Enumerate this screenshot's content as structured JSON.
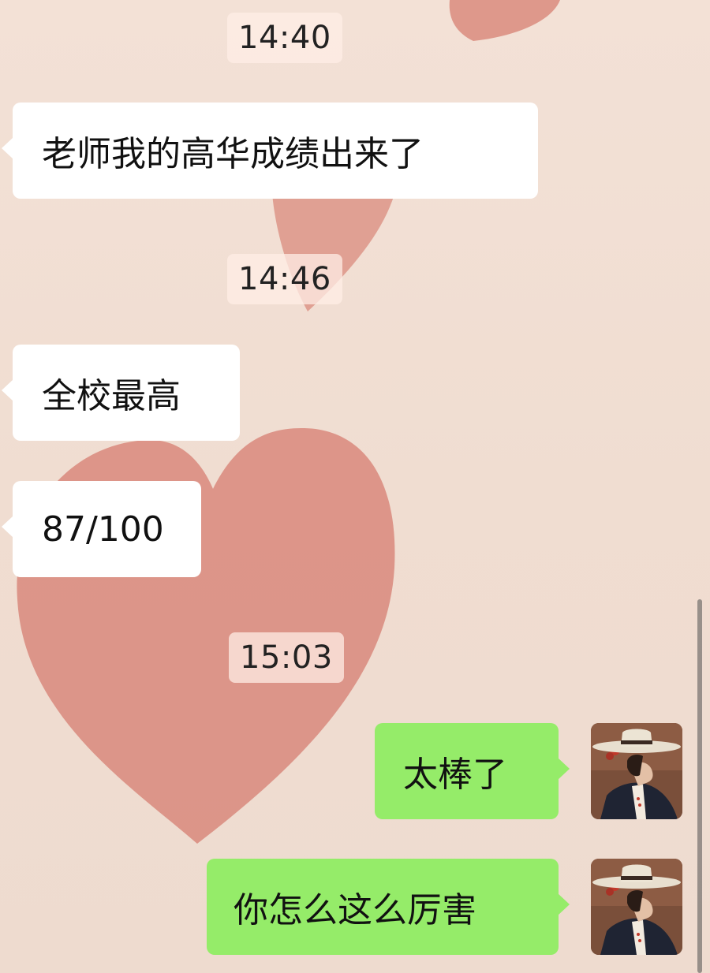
{
  "chat": {
    "timestamps": [
      "14:40",
      "14:46",
      "15:03"
    ],
    "messages": [
      {
        "sender": "contact",
        "text": "老师我的高华成绩出来了"
      },
      {
        "sender": "contact",
        "text": "全校最高"
      },
      {
        "sender": "contact",
        "text": "87/100"
      },
      {
        "sender": "me",
        "text": "太棒了"
      },
      {
        "sender": "me",
        "text": "你怎么这么厉害"
      }
    ]
  },
  "colors": {
    "background": "#f1ded3",
    "incoming_bubble": "#ffffff",
    "outgoing_bubble": "#95ec69",
    "heart": "#d98b7e"
  },
  "icons": {
    "avatar": "avatar-woman-in-wide-brim-hat",
    "background_decoration": "heart-brush-strokes"
  }
}
